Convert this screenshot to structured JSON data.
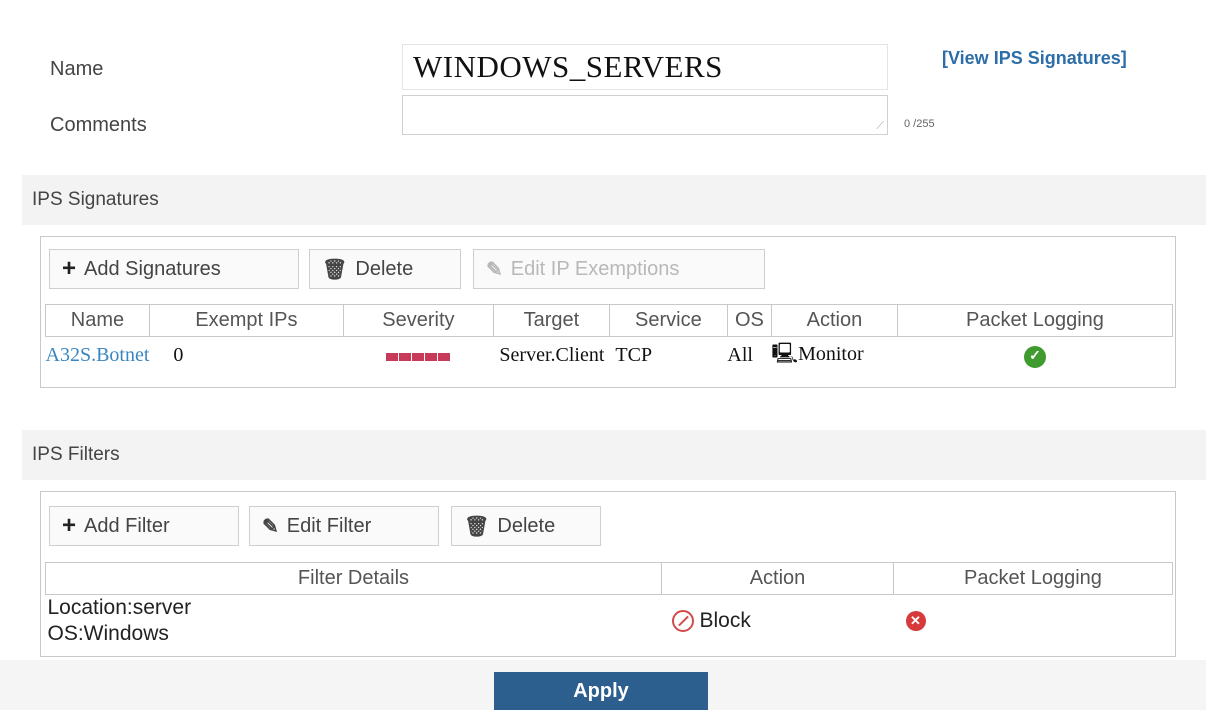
{
  "form": {
    "name_label": "Name",
    "name_value": "WINDOWS_SERVERS",
    "comments_label": "Comments",
    "comments_value": "",
    "char_count": "0 /255",
    "view_signatures_link": "[View IPS Signatures]"
  },
  "signatures": {
    "section_title": "IPS Signatures",
    "toolbar": {
      "add_label": "Add Signatures",
      "delete_label": "Delete",
      "edit_exemptions_label": "Edit IP Exemptions"
    },
    "columns": [
      "Name",
      "Exempt IPs",
      "Severity",
      "Target",
      "Service",
      "OS",
      "Action",
      "Packet Logging"
    ],
    "rows": [
      {
        "name": "A32S.Botnet",
        "exempt_ips": "0",
        "severity_level": 5,
        "target": "Server.Client",
        "service": "TCP",
        "os": "All",
        "action": "Monitor",
        "packet_logging": "enabled"
      }
    ]
  },
  "filters": {
    "section_title": "IPS Filters",
    "toolbar": {
      "add_label": "Add Filter",
      "edit_label": "Edit Filter",
      "delete_label": "Delete"
    },
    "columns": [
      "Filter Details",
      "Action",
      "Packet Logging"
    ],
    "rows": [
      {
        "details_line1": "Location:server",
        "details_line2": "OS:Windows",
        "action": "Block",
        "packet_logging": "disabled"
      }
    ]
  },
  "footer": {
    "apply_label": "Apply"
  },
  "colors": {
    "link": "#2d6ea8",
    "severity": "#c73a5a",
    "apply_button": "#2d5f8e",
    "logging_enabled": "#3f9a2f",
    "logging_disabled": "#d63a3a"
  }
}
